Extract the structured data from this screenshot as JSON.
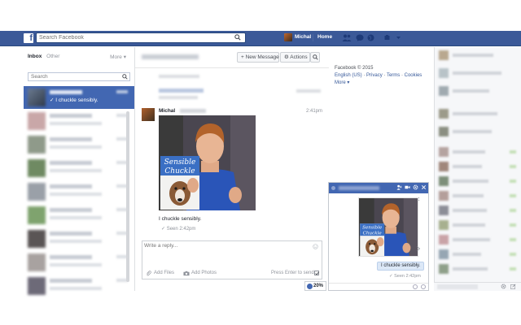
{
  "topbar": {
    "logo_letter": "f",
    "search_placeholder": "Search Facebook",
    "user_name": "Michal",
    "home_label": "Home"
  },
  "inbox": {
    "tab_inbox": "Inbox",
    "tab_other": "Other",
    "more_label": "More ▾",
    "search_placeholder": "Search",
    "active_snippet": "✓ I chuckle sensibly."
  },
  "thread": {
    "new_message_label": "+ New Message",
    "actions_label": "⚙ Actions",
    "sender_name": "Michal",
    "message_time": "2:41pm",
    "image_caption_top": "Sensible",
    "image_caption_bottom": "Chuckle",
    "message_text": "I chuckle sensibly.",
    "seen_text": "✓ Seen 2:42pm",
    "reply_placeholder": "Write a reply...",
    "add_files_label": "Add Files",
    "add_photos_label": "Add Photos",
    "press_enter_label": "Press Enter to send",
    "zoom_label": "20%"
  },
  "right_info": {
    "copyright": "Facebook © 2015",
    "links": [
      "English (US)",
      "Privacy",
      "Terms",
      "Cookies"
    ],
    "more_label": "More ▾"
  },
  "chatbox": {
    "bubble_text": "I chuckle sensibly.",
    "seen_text": "✓ Seen 2:42pm",
    "image_caption_top": "Sensible",
    "image_caption_bottom": "Chuckle"
  },
  "colors": {
    "brand_blue": "#3b5998",
    "active_row": "#4267b2"
  }
}
